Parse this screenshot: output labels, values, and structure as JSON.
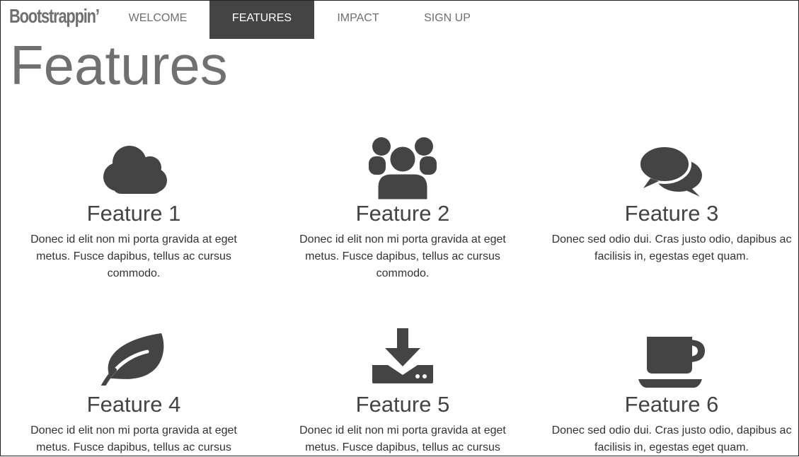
{
  "navbar": {
    "brand": "Bootstrappin’",
    "items": [
      {
        "label": "WELCOME"
      },
      {
        "label": "FEATURES"
      },
      {
        "label": "IMPACT"
      },
      {
        "label": "SIGN UP"
      }
    ],
    "active_item": "FEATURES"
  },
  "page": {
    "title": "Features"
  },
  "features": [
    {
      "title": "Feature 1",
      "icon": "cloud-icon",
      "desc": "Donec id elit non mi porta gravida at eget metus. Fusce dapibus, tellus ac cursus commodo."
    },
    {
      "title": "Feature 2",
      "icon": "users-icon",
      "desc": "Donec id elit non mi porta gravida at eget metus. Fusce dapibus, tellus ac cursus commodo."
    },
    {
      "title": "Feature 3",
      "icon": "chat-bubbles-icon",
      "desc": "Donec sed odio dui. Cras justo odio, dapibus ac facilisis in, egestas eget quam."
    },
    {
      "title": "Feature 4",
      "icon": "leaf-icon",
      "desc": "Donec id elit non mi porta gravida at eget metus. Fusce dapibus, tellus ac cursus"
    },
    {
      "title": "Feature 5",
      "icon": "download-icon",
      "desc": "Donec id elit non mi porta gravida at eget metus. Fusce dapibus, tellus ac cursus"
    },
    {
      "title": "Feature 6",
      "icon": "coffee-cup-icon",
      "desc": "Donec sed odio dui. Cras justo odio, dapibus ac facilisis in, egestas eget quam."
    }
  ],
  "colors": {
    "icon": "#444444",
    "nav_active_bg": "#444444",
    "nav_text": "#6f6f6f",
    "title_text": "#707070"
  }
}
